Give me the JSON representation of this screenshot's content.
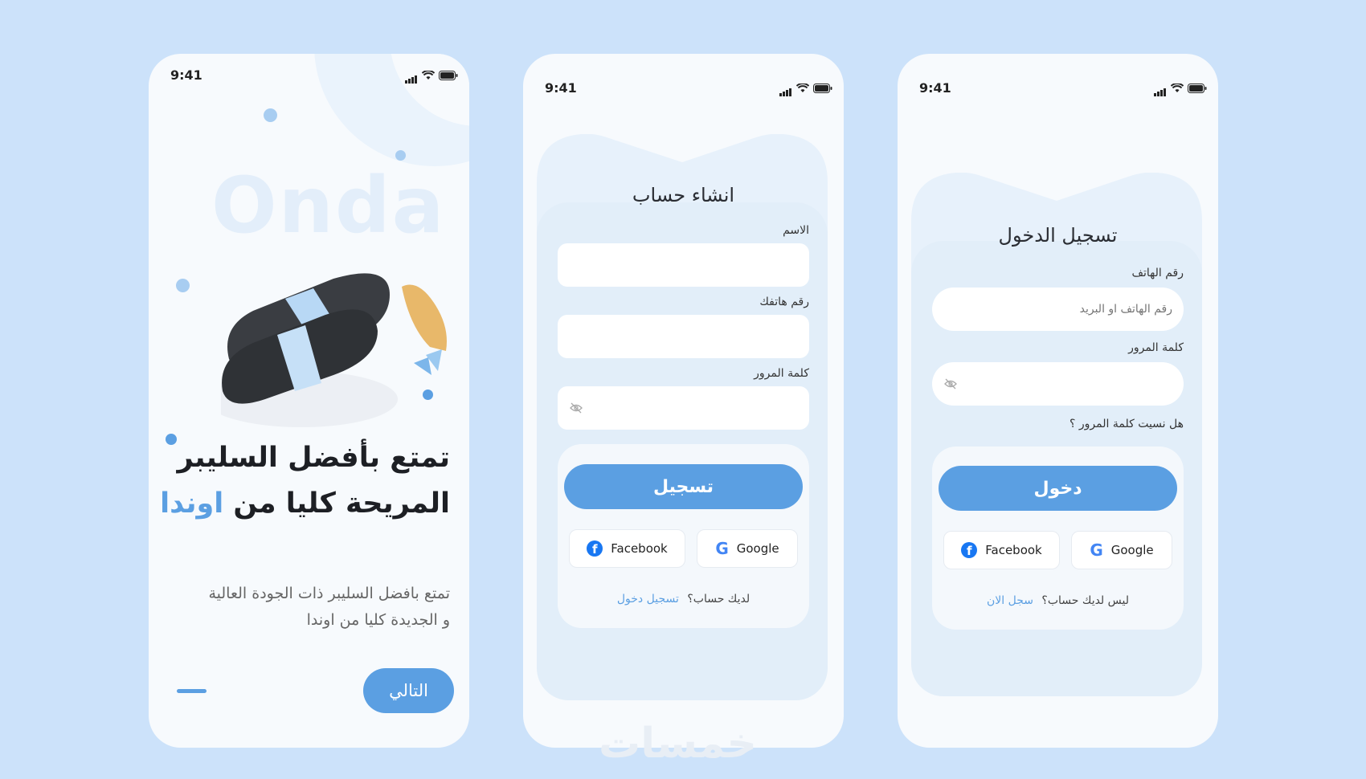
{
  "status": {
    "time": "9:41"
  },
  "onboarding": {
    "brand_watermark": "Onda",
    "headline_line1": "تمتع بأفضل السليبر",
    "headline_line2_prefix": "المريحة كليا من",
    "headline_line2_accent": "اوندا",
    "description_line1": "تمتع بافضل السليبر  ذات الجودة العالية",
    "description_line2": "و الجديدة كليا من  اوندا",
    "next_label": "التالي"
  },
  "signup": {
    "title": "انشاء حساب",
    "name_label": "الاسم",
    "phone_label": "رقم هاتفك",
    "password_label": "كلمة المرور",
    "submit_label": "تسجيل",
    "facebook_label": "Facebook",
    "google_label": "Google",
    "footer_question": "لديك حساب؟",
    "footer_link": "تسجيل دخول"
  },
  "login": {
    "title": "تسجيل الدخول",
    "phone_label": "رقم الهاتف",
    "phone_placeholder": "رقم الهاتف او البريد",
    "password_label": "كلمة المرور",
    "forgot_label": "هل نسيت كلمة المرور ؟",
    "submit_label": "دخول",
    "facebook_label": "Facebook",
    "google_label": "Google",
    "footer_question": "ليس لديك حساب؟",
    "footer_link": "سجل الان"
  },
  "watermark_text": "خمسات",
  "colors": {
    "accent": "#5b9fe2",
    "background": "#cce2fa",
    "card": "#e2eef9"
  },
  "icons": [
    "signal-icon",
    "wifi-icon",
    "battery-icon",
    "eye-off-icon",
    "facebook-icon",
    "google-icon"
  ]
}
